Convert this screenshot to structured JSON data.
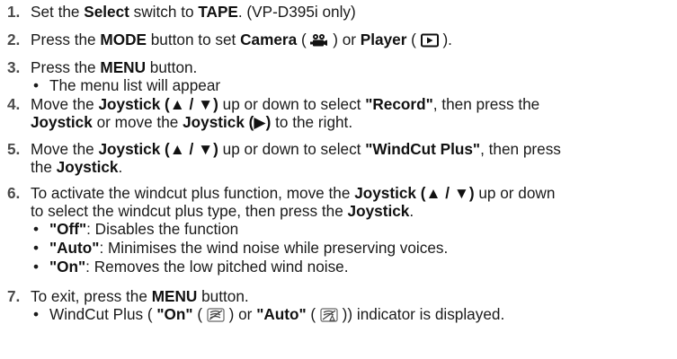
{
  "steps": {
    "s1": {
      "num": "1.",
      "a": "Set the ",
      "select": "Select",
      "b": " switch to ",
      "tape": "TAPE",
      "c": ". (VP-D395i only)"
    },
    "s2": {
      "num": "2.",
      "a": "Press the ",
      "mode": "MODE",
      "b": " button to set ",
      "camera": "Camera",
      "c": " ( ",
      "d": " ) or ",
      "player": "Player",
      "e": " ( ",
      "f": " )."
    },
    "s3": {
      "num": "3.",
      "a": "Press the ",
      "menu": "MENU",
      "b": " button.",
      "bullet": "The menu list will appear"
    },
    "s4": {
      "num": "4.",
      "a": "Move the ",
      "joy1": "Joystick (▲ / ▼)",
      "b": " up or down to select ",
      "record": "\"Record\"",
      "c": ", then press the",
      "joy2": "Joystick",
      "d": " or move the ",
      "joy3": "Joystick (▶)",
      "e": " to the right."
    },
    "s5": {
      "num": "5.",
      "a": "Move the ",
      "joy1": "Joystick (▲ / ▼)",
      "b": " up or down to select ",
      "windcut": "\"WindCut Plus\"",
      "c": ", then press",
      "d": "the ",
      "joy2": "Joystick",
      "e": "."
    },
    "s6": {
      "num": "6.",
      "a": "To activate the windcut plus function, move the ",
      "joy1": "Joystick (▲ / ▼)",
      "b": " up or down",
      "c": "to select the windcut plus type, then press the ",
      "joy2": "Joystick",
      "d": ".",
      "off_label": "\"Off\"",
      "off_text": ": Disables the function",
      "auto_label": "\"Auto\"",
      "auto_text": ": Minimises the wind noise while preserving voices.",
      "on_label": "\"On\"",
      "on_text": ": Removes the low pitched wind noise."
    },
    "s7": {
      "num": "7.",
      "a": "To exit, press the ",
      "menu": "MENU",
      "b": " button.",
      "bullet_a": "WindCut Plus ( ",
      "on": "\"On\"",
      "bullet_b": " ( ",
      "bullet_c": " ) or ",
      "auto": "\"Auto\"",
      "bullet_d": " ( ",
      "bullet_e": " )) indicator is displayed."
    }
  },
  "bullet_char": "•",
  "icons": {
    "camera": "camera-mode-icon",
    "player": "player-mode-icon",
    "windcut_on": "windcut-on-icon",
    "windcut_auto": "windcut-auto-icon"
  }
}
